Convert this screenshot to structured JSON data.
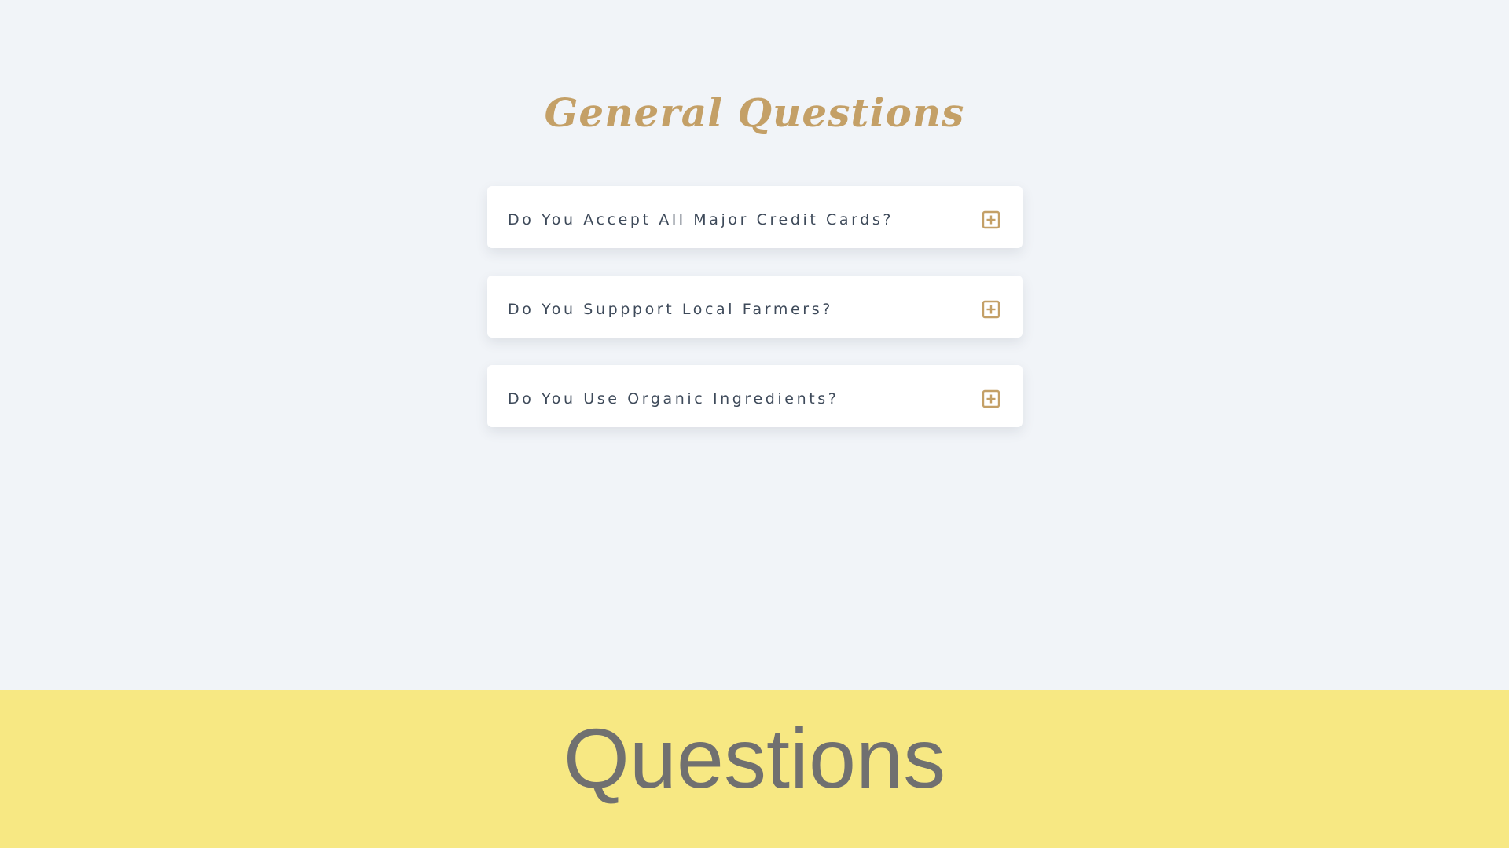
{
  "faq": {
    "title": "General Questions",
    "items": [
      {
        "question": "Do You Accept All Major Credit Cards?",
        "icon": "plus-square-icon"
      },
      {
        "question": "Do You Suppport Local Farmers?",
        "icon": "plus-square-icon"
      },
      {
        "question": "Do You Use Organic Ingredients?",
        "icon": "plus-square-icon"
      }
    ]
  },
  "banner": {
    "title": "Questions"
  },
  "colors": {
    "accent": "#c4a067",
    "background": "#f1f4f8",
    "banner_background": "#f7e883",
    "question_text": "#3e4a5a",
    "banner_text": "#707070"
  }
}
